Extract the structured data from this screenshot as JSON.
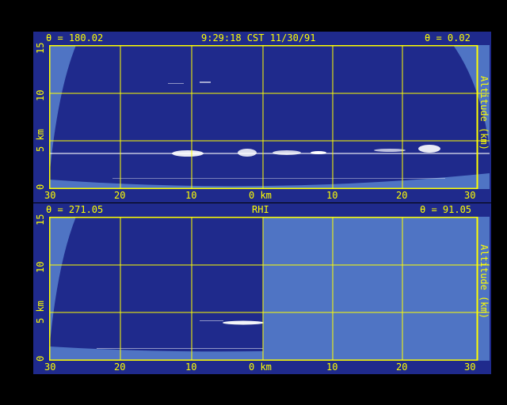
{
  "top_panel": {
    "header": {
      "left": "θ = 180.02",
      "center": "9:29:18 CST 11/30/91",
      "right": "θ = 0.02"
    },
    "y_ticks": [
      "0",
      "5 km",
      "10",
      "15"
    ],
    "x_ticks": [
      "30",
      "20",
      "10",
      "0 km",
      "10",
      "20",
      "30"
    ],
    "right_label": "Altitude (km)"
  },
  "bottom_panel": {
    "header": {
      "left": "θ = 271.05",
      "center": "RHI",
      "right": "θ = 91.05"
    },
    "y_ticks": [
      "0",
      "5 km",
      "10",
      "15"
    ],
    "x_ticks": [
      "30",
      "20",
      "10",
      "0 km",
      "10",
      "20",
      "30"
    ],
    "right_label": "Altitude (km)"
  },
  "colors": {
    "frame": "#ffff00",
    "sky": "#1f2a8c",
    "outside": "#4f74c4",
    "echo": "#ffffff"
  }
}
